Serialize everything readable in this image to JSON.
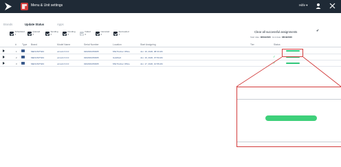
{
  "app": {
    "title": "Menu & Unit settings",
    "help_label": "Hilfe ▾"
  },
  "tabs": [
    {
      "label": "Brands",
      "active": false
    },
    {
      "label": "Update Status",
      "active": true
    },
    {
      "label": "Apps",
      "active": false
    }
  ],
  "filters": [
    {
      "label": "Scheduled\n3",
      "checked": true
    },
    {
      "label": "Queued\n0",
      "checked": true
    },
    {
      "label": "Sending\n0",
      "checked": true
    },
    {
      "label": "Pending\n0",
      "checked": true
    },
    {
      "label": "Failed\n0",
      "checked": false
    },
    {
      "label": "Canceled\n0",
      "checked": true
    },
    {
      "label": "Succeeded\n3",
      "checked": true
    }
  ],
  "clear_label": "Clear all successful assignments",
  "dates": {
    "start_label": "Start date:",
    "start_value": "08/19/2020",
    "end_label": "End date:",
    "end_value": "08/19/2020"
  },
  "columns": [
    "#",
    "Type",
    "Brand",
    "Model Name",
    "Serial Number",
    "Location",
    "Start Assigning",
    "Tier",
    "Status"
  ],
  "rows": [
    {
      "num": "1",
      "brand": "MENUNITS#4",
      "model": "ucmork 6.0.0",
      "serial": "0202301050365",
      "location": "MW Partner Office",
      "start": "Jun. 19, 2020, 08:33 AM",
      "status_color": "#2fc77a",
      "check": false
    },
    {
      "num": "2",
      "brand": "MENUNITS#4",
      "model": "ucmork 6.0.0",
      "serial": "0202301050365",
      "location": "Guildford",
      "start": "Jun. 19, 2020, 07:59 AM",
      "status_color": "#2fc77a",
      "check": true
    },
    {
      "num": "3",
      "brand": "MENUNITS#4",
      "model": "ucmork 6.0.0",
      "serial": "0202301050365",
      "location": "MW Partner Office",
      "start": "Jun. 17, 2020, 10:58 AM",
      "status_color": "#2fc77a",
      "check": true
    }
  ],
  "colors": {
    "topbar": "#1f2a36",
    "accent": "#d23b3b",
    "success": "#2fc77a"
  }
}
